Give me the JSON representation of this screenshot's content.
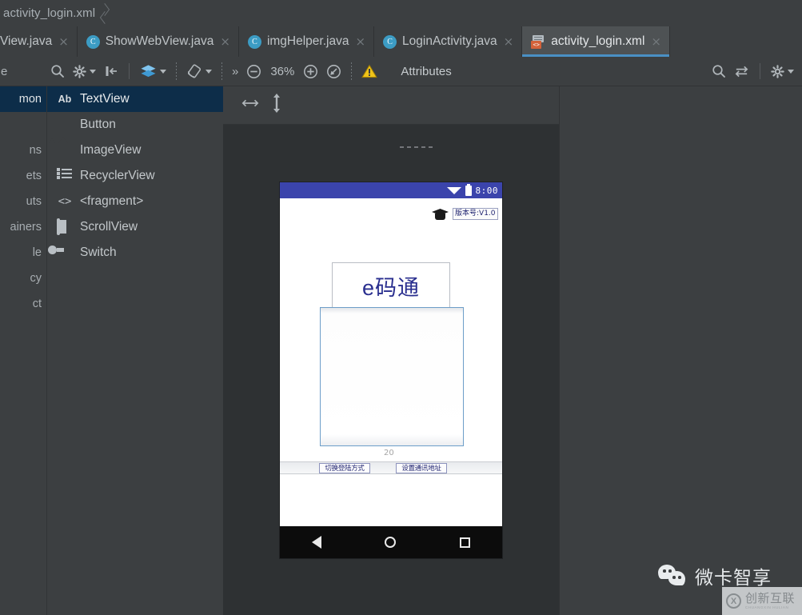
{
  "breadcrumb": {
    "items": [
      "activity_login.xml"
    ]
  },
  "tabs": [
    {
      "label": "View.java",
      "icon": "java-class-icon",
      "close": "×",
      "active": false,
      "truncated": true
    },
    {
      "label": "ShowWebView.java",
      "icon": "java-class-icon",
      "close": "×",
      "active": false
    },
    {
      "label": "imgHelper.java",
      "icon": "java-class-icon",
      "close": "×",
      "active": false
    },
    {
      "label": "LoginActivity.java",
      "icon": "java-class-icon",
      "close": "×",
      "active": false
    },
    {
      "label": "activity_login.xml",
      "icon": "xml-layout-icon",
      "close": "×",
      "active": true
    }
  ],
  "toolbar": {
    "left_label": "e",
    "search_icon": "search-icon",
    "settings_icon": "gear-icon",
    "collapse_icon": "collapse-panel-icon",
    "design_mode_icon": "layers-icon",
    "orientation_icon": "device-rotate-icon",
    "overflow_label": "»",
    "zoom_out_icon": "zoom-out-icon",
    "zoom_level": "36%",
    "zoom_in_icon": "zoom-in-icon",
    "zoom_fit_icon": "zoom-to-fit-icon",
    "warning_icon": "warning-triangle-icon",
    "attributes_title": "Attributes",
    "attr_search_icon": "search-icon",
    "attr_toggle_icon": "swap-arrows-icon",
    "attr_gear_icon": "gear-icon"
  },
  "design_toolbar": {
    "resize_horizontal_icon": "resize-horizontal-icon",
    "resize_vertical_icon": "resize-vertical-icon"
  },
  "palette": {
    "categories": [
      {
        "label": "Common",
        "visible_text": "mon",
        "selected": true
      },
      {
        "label": "Buttons",
        "visible_text": "ns",
        "selected": false
      },
      {
        "label": "Widgets",
        "visible_text": "ets",
        "selected": false
      },
      {
        "label": "Layouts",
        "visible_text": "uts",
        "selected": false
      },
      {
        "label": "Containers",
        "visible_text": "ainers",
        "selected": false
      },
      {
        "label": "Google",
        "visible_text": "le",
        "selected": false
      },
      {
        "label": "Legacy",
        "visible_text": "cy",
        "selected": false
      },
      {
        "label": "Project",
        "visible_text": "ct",
        "selected": false
      }
    ],
    "items": [
      {
        "label": "TextView",
        "icon": "textview-ab-icon",
        "selected": true
      },
      {
        "label": "Button",
        "icon": "button-icon",
        "selected": false
      },
      {
        "label": "ImageView",
        "icon": "imageview-icon",
        "selected": false
      },
      {
        "label": "RecyclerView",
        "icon": "recyclerview-icon",
        "selected": false
      },
      {
        "label": "<fragment>",
        "icon": "fragment-icon",
        "selected": false
      },
      {
        "label": "ScrollView",
        "icon": "scrollview-icon",
        "selected": false
      },
      {
        "label": "Switch",
        "icon": "switch-icon",
        "selected": false
      }
    ]
  },
  "device_preview": {
    "status_bar": {
      "time": "8:00",
      "wifi_icon": "wifi-icon",
      "battery_icon": "battery-icon",
      "color": "#3b44ac"
    },
    "widgets": {
      "logo_icon": "graduation-cap-icon",
      "version_tag": "版本号:V1.0",
      "app_title": "e码通",
      "button_left": "切换登陆方式",
      "button_right": "设置通讯地址",
      "margin_label": "20"
    },
    "nav_bar": {
      "back_icon": "nav-back-icon",
      "home_icon": "nav-home-icon",
      "recents_icon": "nav-recents-icon"
    }
  },
  "watermarks": {
    "wechat": {
      "icon": "wechat-logo-icon",
      "text": "微卡智享"
    },
    "badge": {
      "icon": "cx-logo-icon",
      "main": "创新互联",
      "sub": "CHUANGXIN HULIAN"
    }
  },
  "colors": {
    "chrome": "#3c3f41",
    "tab_active": "#4e5254",
    "accent": "#4a90c4",
    "selection": "#0d2d49",
    "device_status": "#3b44ac",
    "constraint_blue": "#6d9ec9"
  }
}
